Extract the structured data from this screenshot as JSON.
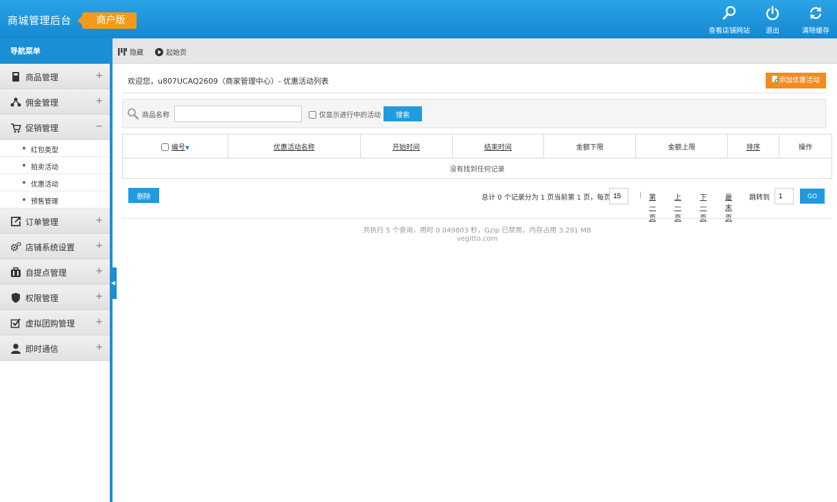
{
  "header": {
    "title": "商城管理后台",
    "edition": "商户版",
    "actions": [
      {
        "label": "查看店铺网站",
        "icon": "search-icon"
      },
      {
        "label": "退出",
        "icon": "power-icon"
      },
      {
        "label": "清除缓存",
        "icon": "refresh-icon"
      }
    ]
  },
  "sidebar": {
    "title": "导航菜单",
    "groups": [
      {
        "label": "商品管理",
        "toggle": "+",
        "icon": "book-icon"
      },
      {
        "label": "佣金管理",
        "toggle": "+",
        "icon": "share-icon"
      },
      {
        "label": "促销管理",
        "toggle": "−",
        "icon": "cart-icon"
      },
      {
        "label": "订单管理",
        "toggle": "+",
        "icon": "export-icon"
      },
      {
        "label": "店铺系统设置",
        "toggle": "+",
        "icon": "gears-icon"
      },
      {
        "label": "自提点管理",
        "toggle": "+",
        "icon": "briefcase-icon"
      },
      {
        "label": "权限管理",
        "toggle": "+",
        "icon": "shield-icon"
      },
      {
        "label": "虚拟团购管理",
        "toggle": "+",
        "icon": "checkbox-icon"
      },
      {
        "label": "即时通信",
        "toggle": "+",
        "icon": "user-icon"
      }
    ],
    "promo_items": [
      "红包类型",
      "拍卖活动",
      "优惠活动",
      "预售管理"
    ]
  },
  "toolbar": {
    "hide_label": "隐藏",
    "home_label": "起始页"
  },
  "main": {
    "welcome": "欢迎您，u807UCAQ2609（商家管理中心）- 优惠活动列表",
    "add_button": "添加优惠活动",
    "search": {
      "label": "商品名称",
      "value": "",
      "placeholder": "",
      "only_active_label": "仅显示进行中的活动",
      "button": "搜索"
    },
    "table": {
      "columns": [
        "编号",
        "优惠活动名称",
        "开始时间",
        "结束时间",
        "金额下限",
        "金额上限",
        "排序",
        "操作"
      ],
      "empty_message": "没有找到任何记录"
    },
    "delete_button": "删除",
    "pager": {
      "summary": "总计 0 个记录分为 1 页当前第 1 页，每页",
      "page_size": "15",
      "separator": "|",
      "first": "第一页",
      "prev": "上一页",
      "next": "下一页",
      "last": "最末页",
      "jump_label": "跳转到",
      "jump_value": "1",
      "go": "GO"
    },
    "footer": {
      "stats": "共执行 5 个查询，用时 0.049803 秒，Gzip 已禁用，内存占用 3.291 MB",
      "domain": "vegitto.com"
    }
  },
  "colors": {
    "header_blue": "#1a8fd6",
    "accent_orange": "#f39a1a",
    "button_blue": "#1f9be0"
  }
}
